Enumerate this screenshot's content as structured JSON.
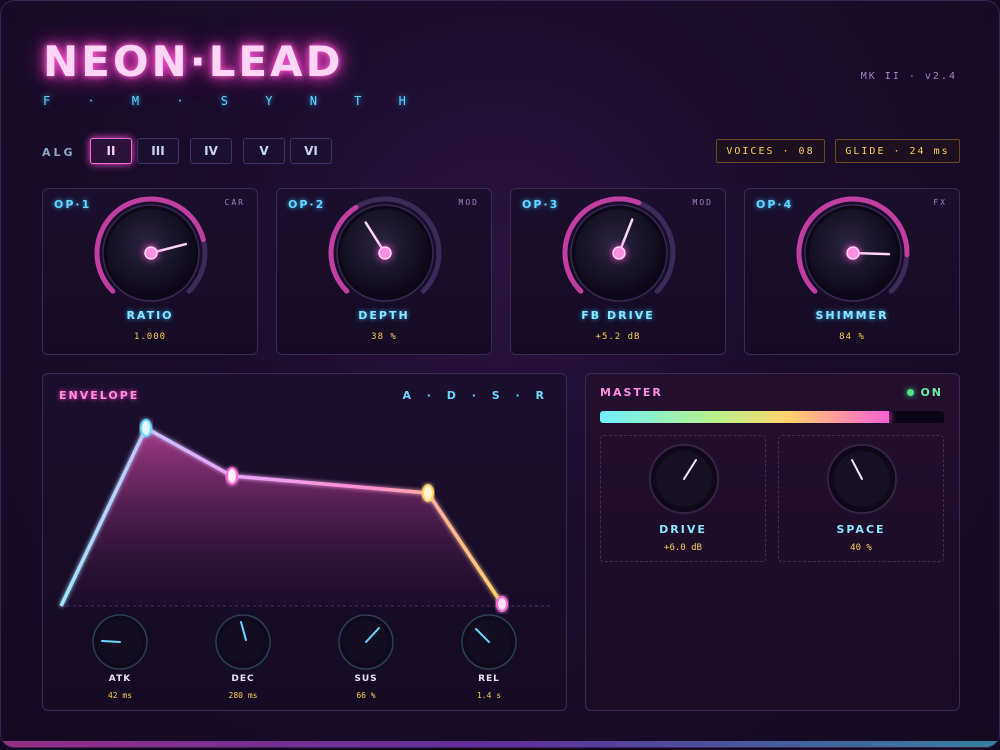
{
  "header": {
    "title": "NEON·LEAD",
    "subtitle": "F · M · S Y N T H",
    "version": "MK II · v2.4"
  },
  "algorithm": {
    "label": "ALG",
    "options": [
      "II",
      "III",
      "IV",
      "V",
      "VI"
    ],
    "selected": "II"
  },
  "readouts": {
    "voices": "VOICES · 08",
    "glide": "GLIDE · 24 ms"
  },
  "operators": [
    {
      "title": "OP·1",
      "tag": "CAR",
      "param": "RATIO",
      "value": "1.000",
      "level": 0.78
    },
    {
      "title": "OP·2",
      "tag": "MOD",
      "param": "DEPTH",
      "value": "38 %",
      "level": 0.38
    },
    {
      "title": "OP·3",
      "tag": "MOD",
      "param": "FB DRIVE",
      "value": "+5.2 dB",
      "level": 0.58
    },
    {
      "title": "OP·4",
      "tag": "FX",
      "param": "SHIMMER",
      "value": "84 %",
      "level": 0.84
    }
  ],
  "envelope": {
    "title": "ENVELOPE",
    "stages_label": "A · D · S · R",
    "knobs": [
      {
        "name": "ATK",
        "value": "42 ms"
      },
      {
        "name": "DEC",
        "value": "280 ms"
      },
      {
        "name": "SUS",
        "value": "66 %"
      },
      {
        "name": "REL",
        "value": "1.4 s"
      }
    ]
  },
  "master": {
    "title": "MASTER",
    "status": "ON",
    "level": 0.84,
    "drive": {
      "name": "DRIVE",
      "value": "+6.0 dB"
    },
    "space": {
      "name": "SPACE",
      "value": "40 %"
    }
  },
  "colors": {
    "accent_pink": "#ff5fd6",
    "accent_cyan": "#6ad7ff",
    "value_amber": "#ffcf57",
    "status_green": "#4ee08a"
  }
}
